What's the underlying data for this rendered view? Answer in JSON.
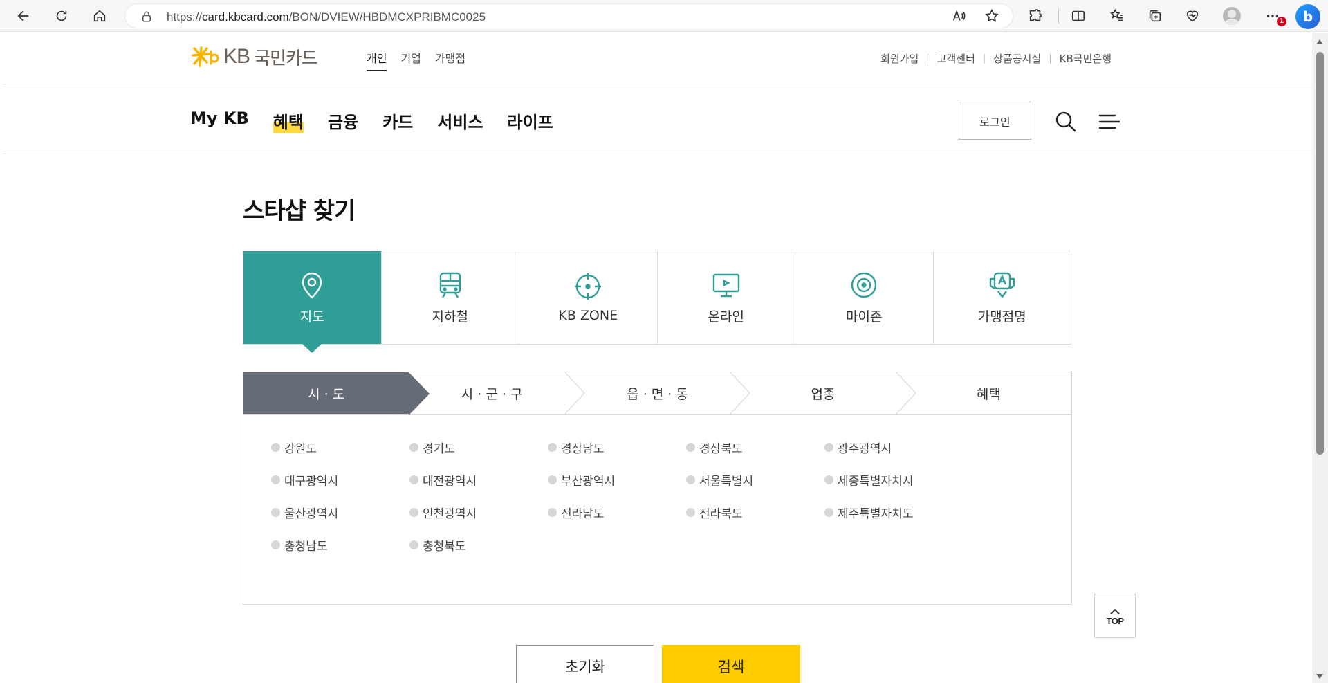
{
  "browser": {
    "url_prefix": "https://",
    "url_host": "card.kbcard.com",
    "url_path": "/BON/DVIEW/HBDMCXPRIBMC0025",
    "notification_count": "1",
    "bing_label": "b"
  },
  "header": {
    "logo_kb": "KB",
    "logo_text": "국민카드",
    "segments": [
      "개인",
      "기업",
      "가맹점"
    ],
    "util_links": [
      "회원가입",
      "고객센터",
      "상품공시실",
      "KB국민은행"
    ]
  },
  "gnb": {
    "menu": [
      "My KB",
      "혜택",
      "금융",
      "카드",
      "서비스",
      "라이프"
    ],
    "login_label": "로그인"
  },
  "page_title": "스타샵 찾기",
  "type_tabs": [
    {
      "label": "지도",
      "icon": "map-pin-icon"
    },
    {
      "label": "지하철",
      "icon": "subway-icon"
    },
    {
      "label": "KB ZONE",
      "icon": "target-icon"
    },
    {
      "label": "온라인",
      "icon": "monitor-icon"
    },
    {
      "label": "마이존",
      "icon": "myzone-icon"
    },
    {
      "label": "가맹점명",
      "icon": "store-name-icon"
    }
  ],
  "steps": [
    "시 · 도",
    "시 · 군 · 구",
    "읍 · 면 · 동",
    "업종",
    "혜택"
  ],
  "regions": [
    "강원도",
    "경기도",
    "경상남도",
    "경상북도",
    "광주광역시",
    "대구광역시",
    "대전광역시",
    "부산광역시",
    "서울특별시",
    "세종특별자치시",
    "울산광역시",
    "인천광역시",
    "전라남도",
    "전라북도",
    "제주특별자치도",
    "충청남도",
    "충청북도"
  ],
  "top_label": "TOP",
  "buttons": {
    "reset": "초기화",
    "search": "검색"
  },
  "colors": {
    "teal": "#2f9e97",
    "step_active": "#666b78",
    "search_yellow": "#ffcc00",
    "highlight": "#ffd83f"
  }
}
